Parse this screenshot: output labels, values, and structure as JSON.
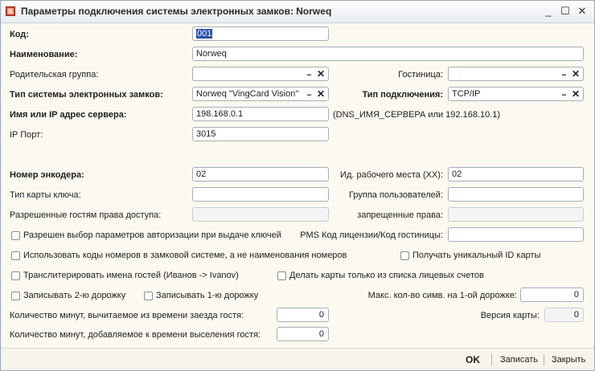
{
  "window": {
    "title": "Параметры подключения системы электронных замков: Norweq",
    "minimize_glyph": "_",
    "maximize_glyph": "☐",
    "close_glyph": "✕"
  },
  "form": {
    "code_label": "Код:",
    "code_value": "001",
    "name_label": "Наименование:",
    "name_value": "Norweq",
    "parent_group_label": "Родительская группа:",
    "parent_group_value": "",
    "hotel_label": "Гостиница:",
    "hotel_value": "",
    "lock_system_type_label": "Тип системы электронных замков:",
    "lock_system_type_value": "Norweq \"VingCard Vision\"",
    "connection_type_label": "Тип подключения:",
    "connection_type_value": "TCP/IP",
    "server_label": "Имя или IP адрес сервера:",
    "server_value": "198.168.0.1",
    "server_hint": "(DNS_ИМЯ_СЕРВЕРА или 192.168.10.1)",
    "ip_port_label": "IP Порт:",
    "ip_port_value": "3015",
    "encoder_number_label": "Номер энкодера:",
    "encoder_number_value": "02",
    "workstation_id_label": "Ид. рабочего места (XX):",
    "workstation_id_value": "02",
    "key_card_type_label": "Тип карты ключа:",
    "key_card_type_value": "",
    "user_group_label": "Группа пользователей:",
    "user_group_value": "",
    "allowed_rights_label": "Разрешенные гостям права доступа:",
    "allowed_rights_value": "",
    "forbidden_rights_label": "запрещенные права:",
    "forbidden_rights_value": "",
    "auth_params_checkbox_label": "Разрешен выбор параметров авторизации при выдаче ключей",
    "pms_license_label": "PMS Код лицензии/Код гостиницы:",
    "pms_license_value": "",
    "use_room_codes_checkbox_label": "Использовать коды номеров в замковой системе, а не наименования номеров",
    "unique_card_id_checkbox_label": "Получать уникальный ID карты",
    "transliterate_checkbox_label": "Транслитерировать имена гостей (Иванов -> Ivanov)",
    "cards_from_accounts_checkbox_label": "Делать карты только из списка лицевых счетов",
    "write_track2_checkbox_label": "Записывать 2-ю дорожку",
    "write_track1_checkbox_label": "Записывать 1-ю дорожку",
    "max_chars_track1_label": "Макс. кол-во симв. на 1-ой дорожке:",
    "max_chars_track1_value": "0",
    "minutes_subtract_label": "Количество минут, вычитаемое из времени заезда гостя:",
    "minutes_subtract_value": "0",
    "card_version_label": "Версия карты:",
    "card_version_value": "0",
    "minutes_add_label": "Количество минут, добавляемое к времени выселения гостя:",
    "minutes_add_value": "0"
  },
  "footer": {
    "ok_label": "OK",
    "save_label": "Записать",
    "close_label": "Закрыть"
  }
}
